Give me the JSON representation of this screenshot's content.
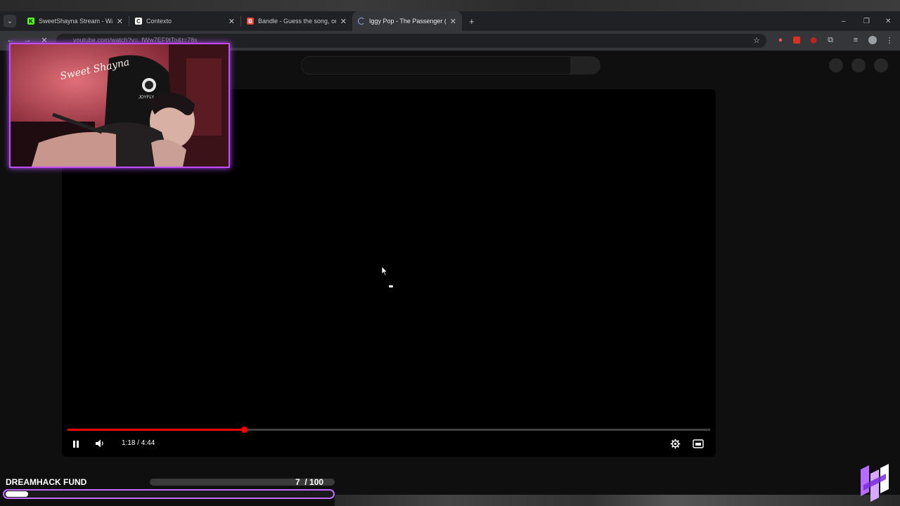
{
  "browser": {
    "tabs": [
      {
        "label": "SweetShayna Stream - Watch L",
        "favicon_letter": "K",
        "favicon_color": "#53fc18"
      },
      {
        "label": "Contexto",
        "favicon_letter": "C",
        "favicon_color": "#ffffff"
      },
      {
        "label": "Bandle - Guess the song, one i",
        "favicon_letter": "B",
        "favicon_color": "#e8453c"
      },
      {
        "label": "Iggy Pop - The Passenger (Offic",
        "favicon_letter": "",
        "favicon_color": "#8ab4f8"
      }
    ],
    "active_tab_index": 3,
    "url": "youtube.com/watch?v=_fWw7EF9tTo&t=78s",
    "window_controls": {
      "minimize": "–",
      "restore": "❐",
      "close": "✕"
    }
  },
  "player": {
    "current_time": "1:18",
    "duration": "4:44",
    "time_display": "1:18 / 4:44",
    "progress_fraction": 0.275,
    "state": "playing",
    "icons": [
      "pause-icon",
      "volume-icon",
      "settings-icon",
      "theater-mode-icon"
    ]
  },
  "webcam": {
    "neon_sign_text": "Sweet Shayna",
    "chair_brand": "JOYFLY",
    "border_color": "#c34cff"
  },
  "overlay": {
    "fund_title": "DREAMHACK FUND",
    "fund_current": "7",
    "fund_goal": "100",
    "fund_count_text": "7  / 100",
    "fund_fraction": 0.07,
    "accent_color": "#c26bff"
  }
}
